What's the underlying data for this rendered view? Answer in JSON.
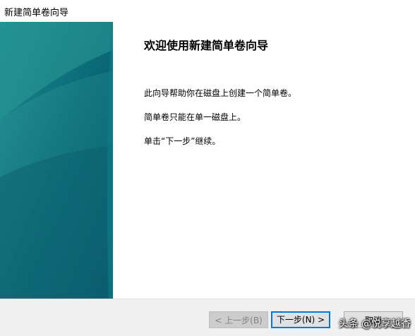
{
  "window": {
    "title": "新建简单卷向导"
  },
  "main": {
    "heading": "欢迎使用新建简单卷向导",
    "paragraphs": [
      "此向导帮助你在磁盘上创建一个简单卷。",
      "简单卷只能在单一磁盘上。",
      "单击“下一步”继续。"
    ]
  },
  "footer": {
    "back_label": "< 上一步(B)",
    "back_enabled": false,
    "next_label": "下一步(N) >",
    "cancel_label": "取消"
  },
  "overlay": {
    "watermark": "头条 @悦享越香"
  },
  "colors": {
    "sidebar_dark": "#0a6a78",
    "sidebar_light": "#2a8f98",
    "accent": "#0078d7"
  }
}
